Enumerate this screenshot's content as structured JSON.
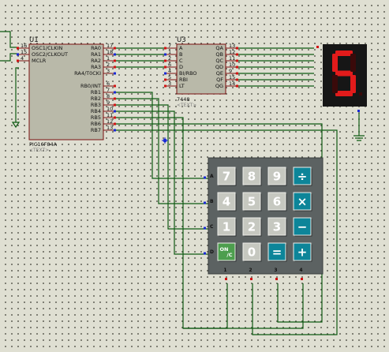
{
  "u1": {
    "ref": "U1",
    "part": "PIC16F84A",
    "sub": "<TEXT>",
    "left_pins": [
      {
        "num": "16",
        "name": "OSC1/CLKIN"
      },
      {
        "num": "15",
        "name": "OSC2/CLKOUT"
      },
      {
        "num": "4",
        "name": "MCLR"
      }
    ],
    "right_pins": [
      {
        "num": "17",
        "name": "RA0"
      },
      {
        "num": "18",
        "name": "RA1"
      },
      {
        "num": "1",
        "name": "RA2"
      },
      {
        "num": "2",
        "name": "RA3"
      },
      {
        "num": "3",
        "name": "RA4/T0CKI"
      },
      {
        "num": "6",
        "name": "RB0/INT"
      },
      {
        "num": "7",
        "name": "RB1"
      },
      {
        "num": "8",
        "name": "RB2"
      },
      {
        "num": "9",
        "name": "RB3"
      },
      {
        "num": "10",
        "name": "RB4"
      },
      {
        "num": "11",
        "name": "RB5"
      },
      {
        "num": "12",
        "name": "RB6"
      },
      {
        "num": "13",
        "name": "RB7"
      }
    ]
  },
  "u3": {
    "ref": "U3",
    "part": "7448",
    "sub": "<TEXT>",
    "left_pins": [
      {
        "num": "7",
        "name": "A"
      },
      {
        "num": "1",
        "name": "B"
      },
      {
        "num": "2",
        "name": "C"
      },
      {
        "num": "6",
        "name": "D"
      },
      {
        "num": "4",
        "name": "BI/RBO"
      },
      {
        "num": "5",
        "name": "RBI"
      },
      {
        "num": "3",
        "name": "LT"
      }
    ],
    "right_pins": [
      {
        "num": "13",
        "name": "QA"
      },
      {
        "num": "12",
        "name": "QB"
      },
      {
        "num": "11",
        "name": "QC"
      },
      {
        "num": "10",
        "name": "QD"
      },
      {
        "num": "9",
        "name": "QE"
      },
      {
        "num": "15",
        "name": "QF"
      },
      {
        "num": "14",
        "name": "QG"
      }
    ]
  },
  "display": {
    "digit": "5",
    "segment_color": "#e21b1b",
    "body_color": "#161616"
  },
  "keypad": {
    "rows": [
      [
        {
          "label": "7",
          "type": "num"
        },
        {
          "label": "8",
          "type": "num"
        },
        {
          "label": "9",
          "type": "num"
        },
        {
          "label": "÷",
          "type": "op"
        }
      ],
      [
        {
          "label": "4",
          "type": "num"
        },
        {
          "label": "5",
          "type": "num"
        },
        {
          "label": "6",
          "type": "num"
        },
        {
          "label": "×",
          "type": "op"
        }
      ],
      [
        {
          "label": "1",
          "type": "num"
        },
        {
          "label": "2",
          "type": "num"
        },
        {
          "label": "3",
          "type": "num"
        },
        {
          "label": "−",
          "type": "op"
        }
      ],
      [
        {
          "label": "ON/C",
          "type": "on"
        },
        {
          "label": "0",
          "type": "num"
        },
        {
          "label": "=",
          "type": "op"
        },
        {
          "label": "+",
          "type": "op"
        }
      ]
    ],
    "row_labels": [
      "A",
      "B",
      "C",
      "D"
    ],
    "col_labels": [
      "1",
      "2",
      "3",
      "4"
    ],
    "colors": {
      "frame": "#5c6262",
      "num": "#c6c8c0",
      "op": "#0d8599",
      "on": "#4d9e4e"
    }
  },
  "colors": {
    "wire": "#0f5a13",
    "pin_marker_red": "#d11414",
    "pin_marker_blue": "#1a2ad6",
    "background": "#dfdfd2"
  }
}
